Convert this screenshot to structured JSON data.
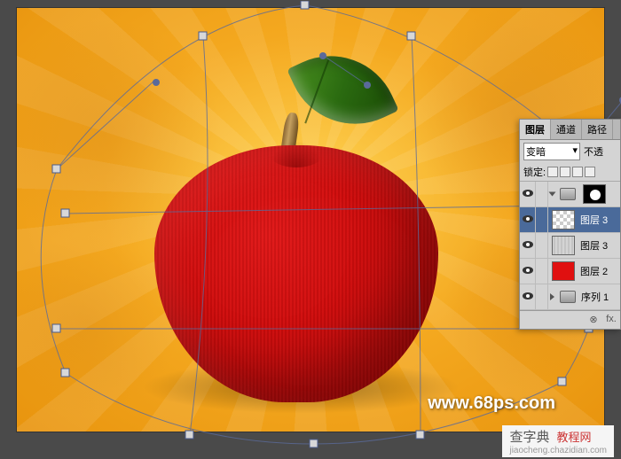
{
  "panel": {
    "tabs": [
      "图层",
      "通道",
      "路径"
    ],
    "blend_mode": "变暗",
    "opacity_label": "不透",
    "lock_label": "锁定:",
    "layers": [
      {
        "name": "",
        "type": "group-mask"
      },
      {
        "name": "图层 3",
        "type": "checker"
      },
      {
        "name": "图层 3",
        "type": "texture"
      },
      {
        "name": "图层 2",
        "type": "red"
      },
      {
        "name": "序列 1",
        "type": "group"
      }
    ],
    "footer": {
      "link": "⊗",
      "fx": "fx."
    }
  },
  "watermark": "www.68ps.com",
  "footer_text": {
    "main": "查字典",
    "sub": "教程网",
    "url": "jiaocheng.chazidian.com"
  }
}
